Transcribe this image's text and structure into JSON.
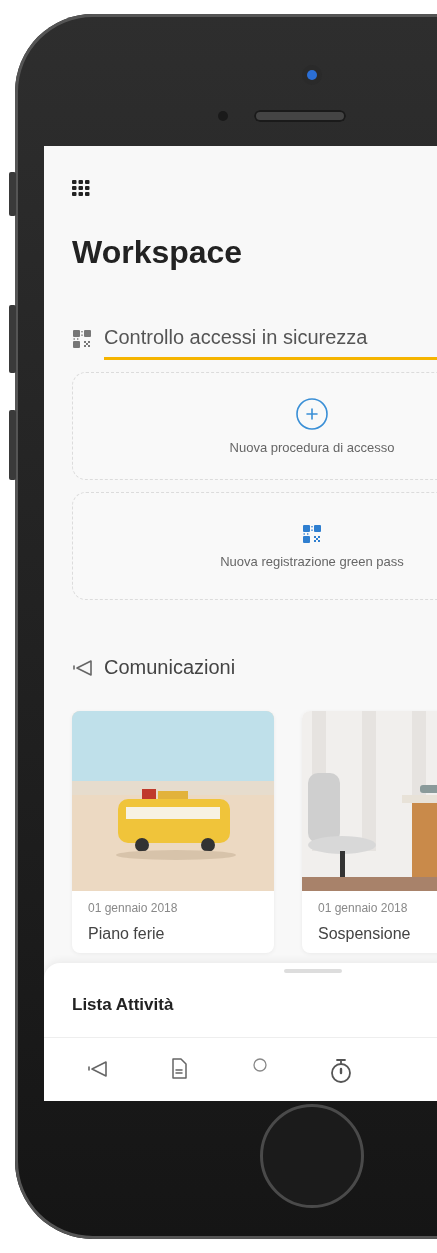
{
  "header": {
    "title": "Workspace"
  },
  "access_section": {
    "title": "Controllo accessi in sicurezza",
    "actions": [
      {
        "kind": "add",
        "label": "Nuova procedura di accesso"
      },
      {
        "kind": "qr",
        "label": "Nuova registrazione green pass"
      }
    ]
  },
  "communications": {
    "title": "Comunicazioni",
    "cards": [
      {
        "kind": "picture",
        "date": "01 gennaio 2018",
        "title": "Piano ferie"
      },
      {
        "kind": "picture",
        "date": "01 gennaio 2018",
        "title": "Sospensione"
      }
    ]
  },
  "bottom_sheet": {
    "title": "Lista Attività"
  },
  "nav_items": [
    {
      "kind": "megaphone"
    },
    {
      "kind": "document"
    },
    {
      "kind": "circle"
    },
    {
      "kind": "stopwatch"
    }
  ]
}
